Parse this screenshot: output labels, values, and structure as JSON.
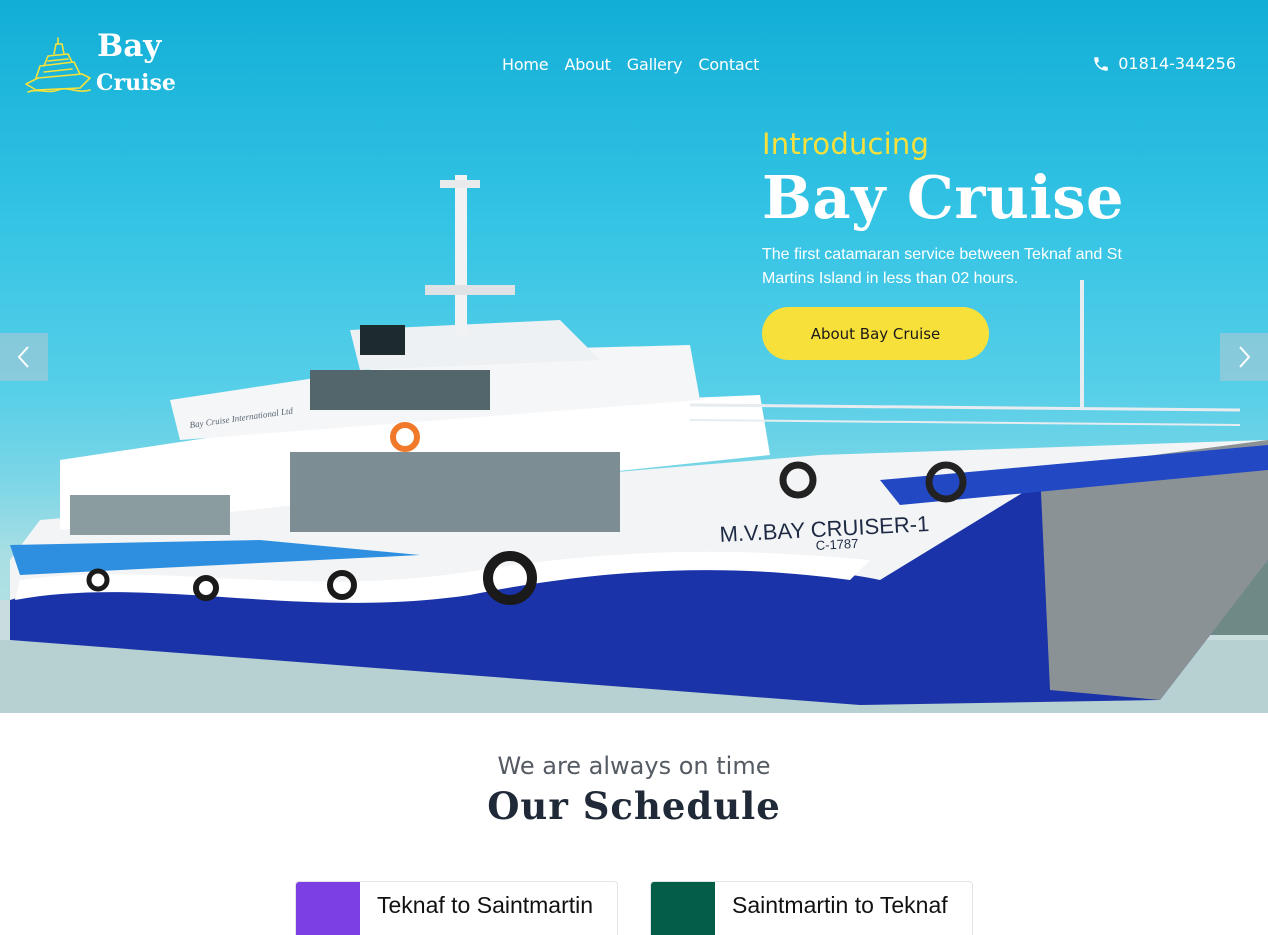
{
  "brand": {
    "line1": "Bay",
    "line2": "Cruise",
    "logo_icon": "ship-icon",
    "logo_color": "#f5e23a"
  },
  "nav": {
    "items": [
      {
        "label": "Home"
      },
      {
        "label": "About"
      },
      {
        "label": "Gallery"
      },
      {
        "label": "Contact"
      }
    ]
  },
  "contact": {
    "phone_icon": "phone-icon",
    "phone": "01814-344256"
  },
  "hero": {
    "kicker": "Introducing",
    "title": "Bay Cruise",
    "description": "The first catamaran service between Teknaf and St Martins Island in less than 02 hours.",
    "cta_label": "About Bay Cruise",
    "accent_color": "#f8e03a",
    "ship_name": "M.V.BAY CRUISER-1",
    "ship_reg": "C-1787",
    "ship_banner": "Bay Cruise International Ltd",
    "prev_icon": "chevron-left-icon",
    "next_icon": "chevron-right-icon"
  },
  "schedule": {
    "subtitle": "We are always on time",
    "title": "Our Schedule",
    "routes": [
      {
        "label": "Teknaf to Saintmartin",
        "color": "#7b3fe4"
      },
      {
        "label": "Saintmartin to Teknaf",
        "color": "#045d46"
      }
    ]
  }
}
